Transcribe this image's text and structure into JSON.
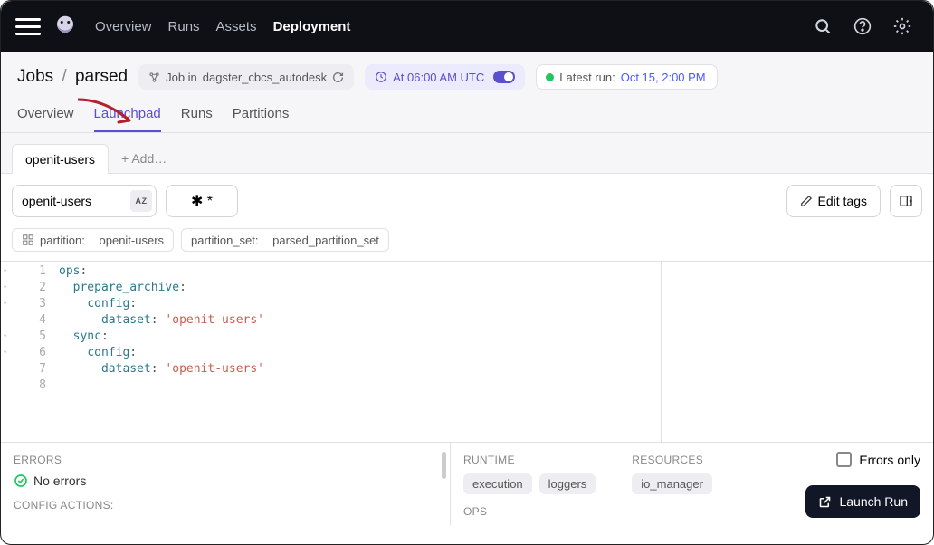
{
  "nav": {
    "items": [
      "Overview",
      "Runs",
      "Assets",
      "Deployment"
    ],
    "active_index": 3
  },
  "breadcrumb": {
    "root": "Jobs",
    "current": "parsed"
  },
  "code_location": {
    "prefix": "Job in",
    "name": "dagster_cbcs_autodesk"
  },
  "schedule": {
    "label": "At 06:00 AM UTC"
  },
  "latest_run": {
    "prefix": "Latest run:",
    "time": "Oct 15, 2:00 PM"
  },
  "sub_tabs": {
    "items": [
      "Overview",
      "Launchpad",
      "Runs",
      "Partitions"
    ],
    "active_index": 1
  },
  "preset_tabs": {
    "active": "openit-users",
    "add": "+ Add…"
  },
  "preset_input": {
    "value": "openit-users"
  },
  "scaffold": {
    "label": "✱ *"
  },
  "edit_tags": {
    "label": "Edit tags"
  },
  "tags": {
    "partition": {
      "key": "partition:",
      "value": "openit-users"
    },
    "partition_set": {
      "key": "partition_set:",
      "value": "parsed_partition_set"
    }
  },
  "code_lines": [
    {
      "key": "ops",
      "indent": 0,
      "type": "map"
    },
    {
      "key": "prepare_archive",
      "indent": 1,
      "type": "map"
    },
    {
      "key": "config",
      "indent": 2,
      "type": "map"
    },
    {
      "key": "dataset",
      "indent": 3,
      "type": "kv",
      "value": "'openit-users'"
    },
    {
      "key": "sync",
      "indent": 1,
      "type": "map"
    },
    {
      "key": "config",
      "indent": 2,
      "type": "map"
    },
    {
      "key": "dataset",
      "indent": 3,
      "type": "kv",
      "value": "'openit-users'"
    }
  ],
  "errors_panel": {
    "title": "ERRORS",
    "no_errors": "No errors",
    "config_actions": "CONFIG ACTIONS:"
  },
  "runtime_panel": {
    "runtime_title": "RUNTIME",
    "resources_title": "RESOURCES",
    "ops_title": "OPS",
    "runtime_chips": [
      "execution",
      "loggers"
    ],
    "resource_chips": [
      "io_manager"
    ],
    "errors_only": "Errors only"
  },
  "launch_button": "Launch Run"
}
